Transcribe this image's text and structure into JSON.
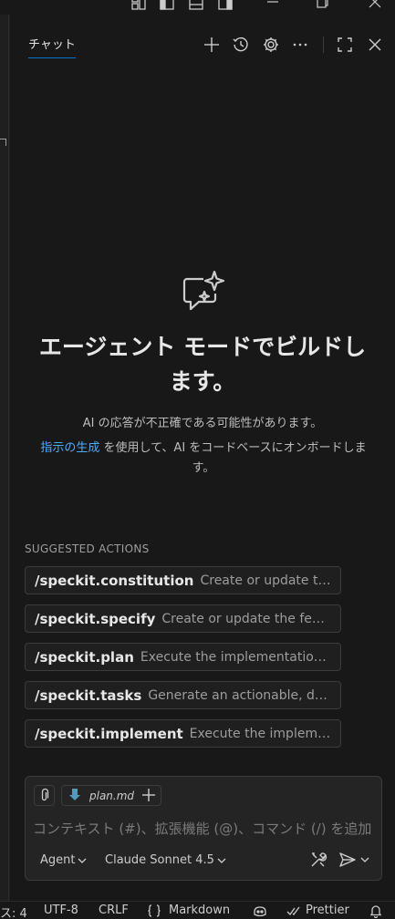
{
  "chat": {
    "tab_label": "チャット"
  },
  "welcome": {
    "title": "エージェント モードでビルドします。",
    "disclaimer": "AI の応答が不正確である可能性があります。",
    "hint_link": "指示の生成",
    "hint_rest": " を使用して、AI をコードベースにオンボードします。"
  },
  "suggested": {
    "heading": "SUGGESTED ACTIONS",
    "items": [
      {
        "command": "/speckit.constitution",
        "description": "Create or update the project constitution"
      },
      {
        "command": "/speckit.specify",
        "description": "Create or update the feature specification"
      },
      {
        "command": "/speckit.plan",
        "description": "Execute the implementation planning workflow"
      },
      {
        "command": "/speckit.tasks",
        "description": "Generate an actionable, dependency-ordered tasks"
      },
      {
        "command": "/speckit.implement",
        "description": "Execute the implementation plan"
      }
    ]
  },
  "input": {
    "attached_file": "plan.md",
    "placeholder": "コンテキスト (#)、拡張機能 (@)、コマンド (/) を追加",
    "mode": "Agent",
    "model": "Claude Sonnet 4.5"
  },
  "statusbar": {
    "spaces": "ス: 4",
    "encoding": "UTF-8",
    "eol": "CRLF",
    "language": "Markdown",
    "formatter": "Prettier"
  },
  "colors": {
    "accent": "#0078d4",
    "link": "#4daafc",
    "background": "#181818"
  },
  "icons": {
    "titlebar": [
      "layout-icon",
      "toggle-primary-sidebar-icon",
      "toggle-panel-icon",
      "toggle-secondary-sidebar-icon",
      "minimize-icon",
      "restore-icon",
      "close-window-icon"
    ],
    "chat_header": [
      "new-chat-plus-icon",
      "history-icon",
      "gear-icon",
      "more-icon",
      "maximize-icon",
      "close-icon"
    ]
  }
}
